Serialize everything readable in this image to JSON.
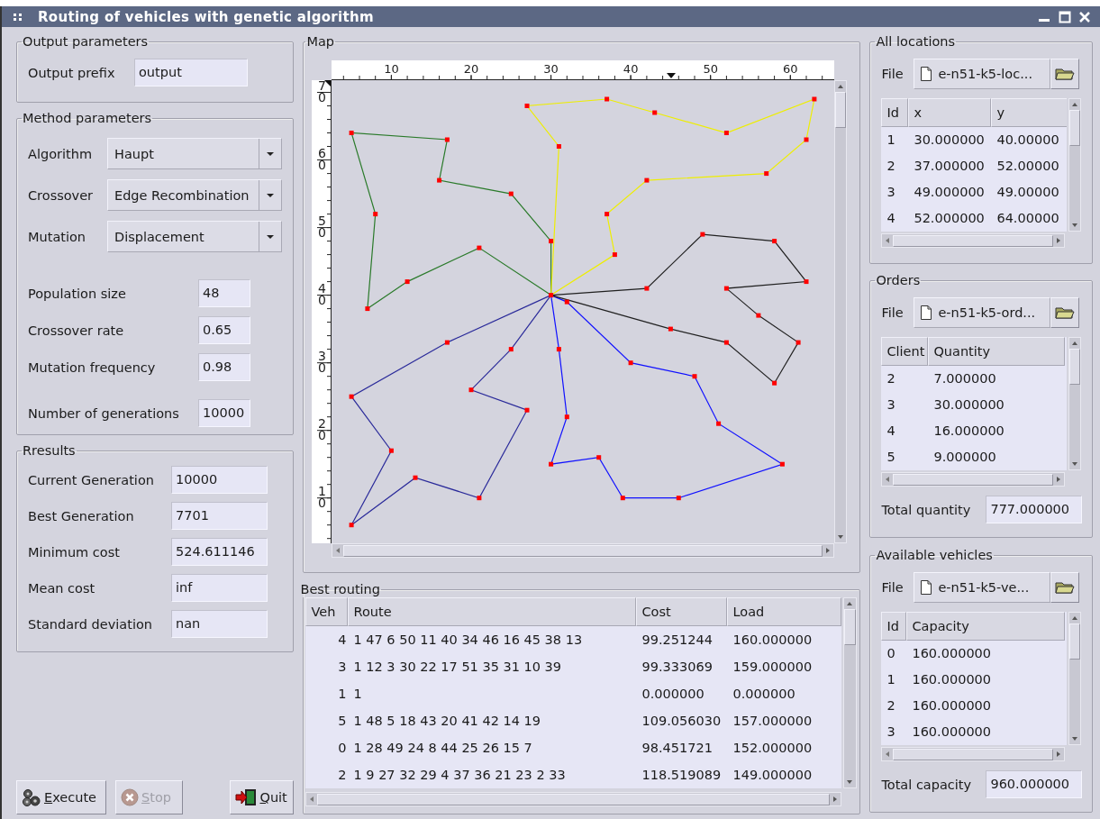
{
  "window": {
    "title": "Routing of vehicles with genetic algorithm"
  },
  "output_parameters": {
    "title": "Output parameters",
    "fields": [
      {
        "label": "Output prefix",
        "value": "output"
      }
    ]
  },
  "method_parameters": {
    "title": "Method parameters",
    "dropdowns": [
      {
        "label": "Algorithm",
        "value": "Haupt"
      },
      {
        "label": "Crossover",
        "value": "Edge Recombination"
      },
      {
        "label": "Mutation",
        "value": "Displacement"
      }
    ],
    "fields": [
      {
        "label": "Population size",
        "value": "48"
      },
      {
        "label": "Crossover rate",
        "value": "0.65"
      },
      {
        "label": "Mutation frequency",
        "value": "0.98"
      },
      {
        "label": "Number of generations",
        "value": "10000"
      }
    ]
  },
  "results": {
    "title": "Rresults",
    "fields": [
      {
        "label": "Current Generation",
        "value": "10000"
      },
      {
        "label": "Best Generation",
        "value": "7701"
      },
      {
        "label": "Minimum cost",
        "value": "524.611146"
      },
      {
        "label": "Mean cost",
        "value": "inf"
      },
      {
        "label": "Standard deviation",
        "value": "nan"
      }
    ]
  },
  "buttons": [
    {
      "label": "Execute",
      "kind": "execute",
      "mnemonic": true,
      "disabled": false
    },
    {
      "label": "Stop",
      "kind": "stop",
      "mnemonic": true,
      "disabled": true
    },
    {
      "label": "Quit",
      "kind": "quit",
      "mnemonic": true,
      "disabled": false
    }
  ],
  "map": {
    "title": "Map",
    "ruler_x_labels": [
      "10",
      "20",
      "30",
      "40",
      "50",
      "60"
    ],
    "ruler_y_labels": [
      "70",
      "60",
      "50",
      "40",
      "30",
      "20",
      "10"
    ]
  },
  "best_routing": {
    "title": "Best routing",
    "columns": [
      "Veh",
      "Route",
      "Cost",
      "Load"
    ],
    "rows": [
      [
        "4",
        "1 47 6 50 11 40 34 46 16 45 38 13",
        "99.251244",
        "160.000000"
      ],
      [
        "3",
        "1 12 3 30 22 17 51 35 31 10 39",
        "99.333069",
        "159.000000"
      ],
      [
        "1",
        "1",
        "0.000000",
        "0.000000"
      ],
      [
        "5",
        "1 48 5 18 43 20 41 42 14 19",
        "109.056030",
        "157.000000"
      ],
      [
        "0",
        "1 28 49 24 8 44 25 26 15 7",
        "98.451721",
        "152.000000"
      ],
      [
        "2",
        "1 9 27 32 29 4 37 36 21 23 2 33",
        "118.519089",
        "149.000000"
      ]
    ]
  },
  "all_locations": {
    "title": "All locations",
    "file_label": "File",
    "file": "e-n51-k5-loc...",
    "columns": [
      "Id",
      "x",
      "y"
    ],
    "rows": [
      [
        "1",
        "30.000000",
        "40.00000"
      ],
      [
        "2",
        "37.000000",
        "52.00000"
      ],
      [
        "3",
        "49.000000",
        "49.00000"
      ],
      [
        "4",
        "52.000000",
        "64.00000"
      ]
    ]
  },
  "orders": {
    "title": "Orders",
    "file_label": "File",
    "file": "e-n51-k5-ord...",
    "columns": [
      "Client",
      "Quantity"
    ],
    "rows": [
      [
        "2",
        "7.000000"
      ],
      [
        "3",
        "30.000000"
      ],
      [
        "4",
        "16.000000"
      ],
      [
        "5",
        "9.000000"
      ]
    ],
    "total": {
      "label": "Total quantity",
      "value": "777.000000"
    }
  },
  "vehicles": {
    "title": "Available vehicles",
    "file_label": "File",
    "file": "e-n51-k5-ve...",
    "columns": [
      "Id",
      "Capacity"
    ],
    "rows": [
      [
        "0",
        "160.000000"
      ],
      [
        "1",
        "160.000000"
      ],
      [
        "2",
        "160.000000"
      ],
      [
        "3",
        "160.000000"
      ]
    ],
    "total": {
      "label": "Total capacity",
      "value": "960.000000"
    }
  }
}
